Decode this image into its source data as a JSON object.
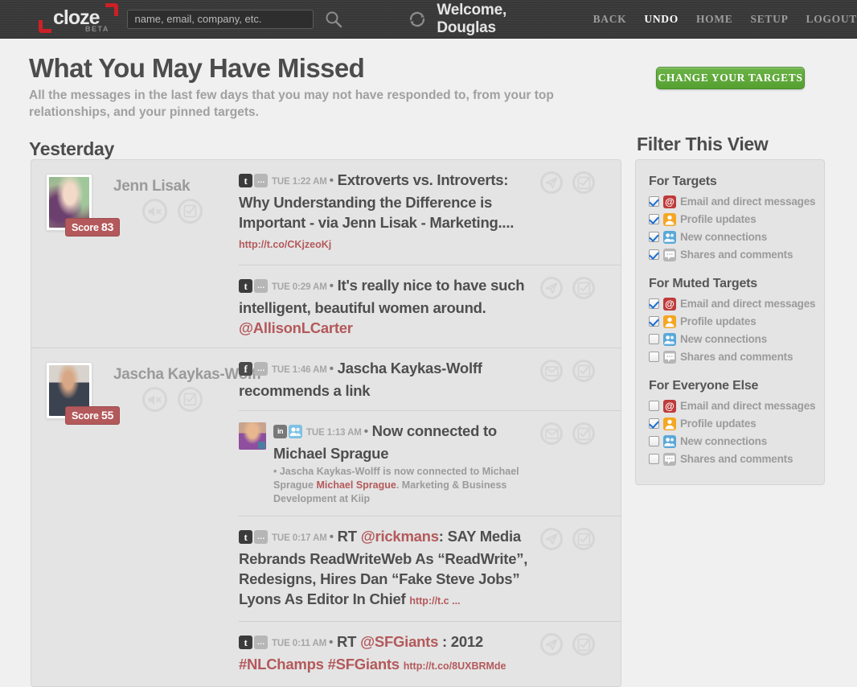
{
  "header": {
    "logo_text": "cloze",
    "logo_beta": "BETA",
    "search_placeholder": "name, email, company, etc.",
    "search_value": "",
    "welcome": "Welcome, Douglas",
    "nav": [
      {
        "label": "BACK",
        "active": false
      },
      {
        "label": "UNDO",
        "active": true
      },
      {
        "label": "HOME",
        "active": false
      },
      {
        "label": "SETUP",
        "active": false
      },
      {
        "label": "LOGOUT",
        "active": false
      }
    ],
    "icons": {
      "search": "search-icon",
      "refresh": "refresh-icon"
    }
  },
  "page": {
    "title": "What You May Have Missed",
    "subtitle": "All the messages in the last few days that you may not have responded to, from your top relationships, and your pinned targets.",
    "day_heading": "Yesterday",
    "change_targets_label": "CHANGE YOUR TARGETS"
  },
  "feed": {
    "people": [
      {
        "name": "Jenn Lisak",
        "score_label": "Score",
        "score": "83",
        "mute_icon": "mute-icon",
        "done_icon": "checkbox-circle-icon",
        "messages": [
          {
            "source": "twitter",
            "source_glyph": "t",
            "has_chat_badge": true,
            "time": "TUE 1:22 AM",
            "action_icon": "send-icon",
            "text_parts": [
              {
                "t": "Extroverts vs. Introverts: Why Understanding the Difference is Important - via Jenn Lisak - Marketing.... ",
                "k": "plain"
              },
              {
                "t": "http://t.co/CKjzeoKj",
                "k": "url"
              }
            ]
          },
          {
            "source": "twitter",
            "source_glyph": "t",
            "has_chat_badge": true,
            "time": "TUE 0:29 AM",
            "action_icon": "send-icon",
            "text_parts": [
              {
                "t": "It's really nice to have such intelligent, beautiful women around. ",
                "k": "plain"
              },
              {
                "t": "@AllisonLCarter",
                "k": "mention"
              }
            ]
          }
        ]
      },
      {
        "name": "Jascha Kaykas-Wolff",
        "score_label": "Score",
        "score": "55",
        "mute_icon": "mute-icon",
        "done_icon": "checkbox-circle-icon",
        "messages": [
          {
            "source": "facebook",
            "source_glyph": "f",
            "has_chat_badge": true,
            "time": "TUE 1:46 AM",
            "action_icon": "email-icon",
            "text_parts": [
              {
                "t": "Jascha Kaykas-Wolff recommends a link",
                "k": "plain"
              }
            ]
          },
          {
            "source": "linkedin",
            "source_glyph": "in",
            "has_person_badge": true,
            "nested_avatar": true,
            "time": "TUE 1:13 AM",
            "action_icon": "email-icon",
            "text_parts": [
              {
                "t": "Now connected to Michael Sprague",
                "k": "plain"
              }
            ],
            "sub_parts": [
              {
                "t": "• Jascha Kaykas-Wolff is now connected to Michael Sprague ",
                "k": "plain"
              },
              {
                "t": "Michael Sprague",
                "k": "hl"
              },
              {
                "t": ". Marketing & Business Development at Kiip",
                "k": "plain"
              }
            ]
          },
          {
            "source": "twitter",
            "source_glyph": "t",
            "has_chat_badge": true,
            "time": "TUE 0:17 AM",
            "action_icon": "send-icon",
            "text_parts": [
              {
                "t": "RT ",
                "k": "plain"
              },
              {
                "t": "@rickmans",
                "k": "mention"
              },
              {
                "t": ": SAY Media Rebrands ReadWriteWeb As “ReadWrite”, Redesigns, Hires Dan “Fake Steve Jobs” Lyons As Editor In Chief ",
                "k": "plain"
              },
              {
                "t": "http://t.c ...",
                "k": "url"
              }
            ]
          },
          {
            "source": "twitter",
            "source_glyph": "t",
            "has_chat_badge": true,
            "time": "TUE 0:11 AM",
            "action_icon": "send-icon",
            "text_parts": [
              {
                "t": "RT ",
                "k": "plain"
              },
              {
                "t": "@SFGiants",
                "k": "mention"
              },
              {
                "t": " : 2012 ",
                "k": "plain"
              },
              {
                "t": "#NLChamps",
                "k": "tag"
              },
              {
                "t": " ",
                "k": "plain"
              },
              {
                "t": "#SFGiants",
                "k": "tag"
              },
              {
                "t": " ",
                "k": "plain"
              },
              {
                "t": "http://t.co/8UXBRMde",
                "k": "url"
              }
            ]
          }
        ]
      }
    ]
  },
  "filter": {
    "title": "Filter This View",
    "groups": [
      {
        "heading": "For Targets",
        "rows": [
          {
            "label": "Email and direct messages",
            "icon": "at-icon",
            "icon_class": "fi-at",
            "checked": true
          },
          {
            "label": "Profile updates",
            "icon": "person-icon",
            "icon_class": "fi-profile",
            "checked": true
          },
          {
            "label": "New connections",
            "icon": "people-icon",
            "icon_class": "fi-conn",
            "checked": true
          },
          {
            "label": "Shares and comments",
            "icon": "chat-icon",
            "icon_class": "fi-share",
            "checked": true
          }
        ]
      },
      {
        "heading": "For Muted Targets",
        "rows": [
          {
            "label": "Email and direct messages",
            "icon": "at-icon",
            "icon_class": "fi-at",
            "checked": true
          },
          {
            "label": "Profile updates",
            "icon": "person-icon",
            "icon_class": "fi-profile",
            "checked": true
          },
          {
            "label": "New connections",
            "icon": "people-icon",
            "icon_class": "fi-conn",
            "checked": false
          },
          {
            "label": "Shares and comments",
            "icon": "chat-icon",
            "icon_class": "fi-share",
            "checked": false
          }
        ]
      },
      {
        "heading": "For Everyone Else",
        "rows": [
          {
            "label": "Email and direct messages",
            "icon": "at-icon",
            "icon_class": "fi-at",
            "checked": false
          },
          {
            "label": "Profile updates",
            "icon": "person-icon",
            "icon_class": "fi-profile",
            "checked": true
          },
          {
            "label": "New connections",
            "icon": "people-icon",
            "icon_class": "fi-conn",
            "checked": false
          },
          {
            "label": "Shares and comments",
            "icon": "chat-icon",
            "icon_class": "fi-share",
            "checked": false
          }
        ]
      }
    ]
  },
  "colors": {
    "accent_red": "#b4595b",
    "brand_red": "#cc2027",
    "green_button": "#5ca834",
    "header_dark": "#3a3a3a",
    "page_bg": "#f0f0f0",
    "card_bg": "#e4e4e4"
  }
}
